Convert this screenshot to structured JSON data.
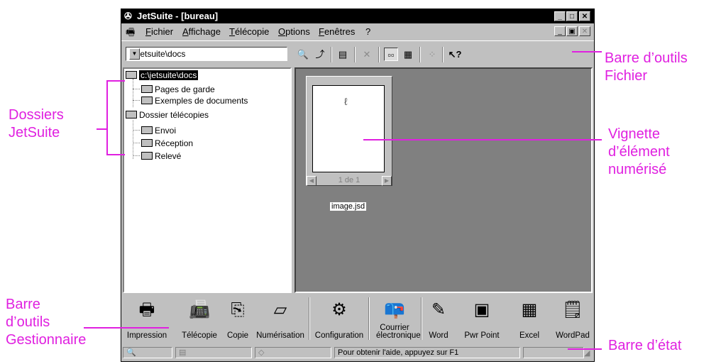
{
  "window": {
    "title": "JetSuite - [bureau]",
    "menus": [
      "Fichier",
      "Affichage",
      "Télécopie",
      "Options",
      "Fenêtres",
      "?"
    ]
  },
  "toolbar": {
    "path": "c:\\jetsuite\\docs"
  },
  "tree": {
    "root": "c:\\jetsuite\\docs",
    "root_children": [
      "Pages de garde",
      "Exemples de documents"
    ],
    "fax_root": "Dossier télécopies",
    "fax_children": [
      "Envoi",
      "Réception",
      "Relevé"
    ]
  },
  "thumbnail": {
    "page_indicator": "1 de 1",
    "filename": "image.jsd"
  },
  "apps": [
    "Impression",
    "Télécopie",
    "Copie",
    "Numérisation",
    "Configuration",
    "Courrier électronique",
    "Word",
    "Pwr Point",
    "Excel",
    "WordPad"
  ],
  "status": {
    "help": "Pour obtenir l'aide, appuyez sur F1"
  },
  "callouts": {
    "file_toolbar": "Barre d’outils\nFichier",
    "folders": "Dossiers\nJetSuite",
    "thumbnail": "Vignette\nd’élément\nnumérisé",
    "manager_toolbar": "Barre\nd’outils\nGestionnaire",
    "status_bar": "Barre d’état"
  },
  "colors": {
    "callout": "#e020e0",
    "window_face": "#c0c0c0",
    "content_bg": "#808080"
  }
}
